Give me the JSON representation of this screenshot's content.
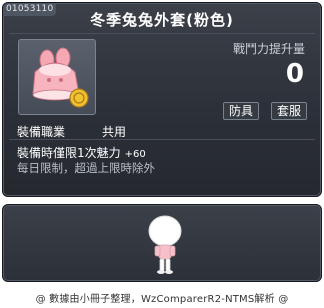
{
  "item": {
    "id": "01053110",
    "name": "冬季兔兔外套(粉色)",
    "power_label": "戰鬥力提升量",
    "power_value": "0",
    "tags": [
      "防具",
      "套服"
    ],
    "job_label": "裝備職業",
    "job_value": "共用",
    "effect_label": "裝備時僅限1次魅力",
    "effect_value": "+60",
    "note": "每日限制，超過上限時除外",
    "icon": "pink-bunny-coat-icon",
    "accent": "#ffffff"
  },
  "preview": {
    "avatar": "avatar-preview"
  },
  "footer": {
    "credit": "@ 數據由小冊子整理，WzComparerR2-NTMS解析 @"
  }
}
